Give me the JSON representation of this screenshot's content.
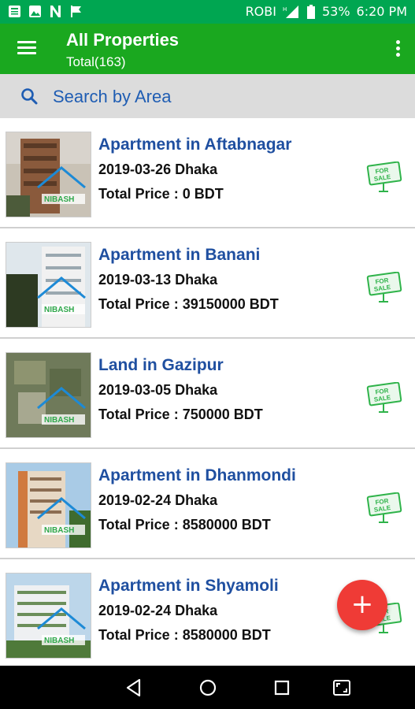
{
  "status_bar": {
    "carrier": "ROBI",
    "battery": "53%",
    "time": "6:20 PM",
    "left_icons": [
      "news-icon",
      "image-icon",
      "n-notification-icon",
      "flag-icon"
    ],
    "network_icon": "signal-icon",
    "battery_icon": "battery-icon"
  },
  "app_bar": {
    "title": "All Properties",
    "subtitle": "Total(163)",
    "menu_icon": "hamburger-menu-icon",
    "overflow_icon": "more-vert-icon"
  },
  "search": {
    "placeholder": "Search by Area",
    "icon": "search-icon"
  },
  "listings": [
    {
      "title": "Apartment in Aftabnagar",
      "meta": "2019-03-26 Dhaka",
      "price": "Total Price : 0 BDT",
      "badge": "for-sale-sign-icon",
      "watermark": "NIBASH"
    },
    {
      "title": "Apartment in Banani",
      "meta": "2019-03-13 Dhaka",
      "price": "Total Price : 39150000 BDT",
      "badge": "for-sale-sign-icon",
      "watermark": "NIBASH"
    },
    {
      "title": "Land in Gazipur",
      "meta": "2019-03-05 Dhaka",
      "price": "Total Price : 750000 BDT",
      "badge": "for-sale-sign-icon",
      "watermark": "NIBASH"
    },
    {
      "title": "Apartment in Dhanmondi",
      "meta": "2019-02-24 Dhaka",
      "price": "Total Price : 8580000 BDT",
      "badge": "for-sale-sign-icon",
      "watermark": "NIBASH"
    },
    {
      "title": "Apartment in Shyamoli",
      "meta": "2019-02-24 Dhaka",
      "price": "Total Price : 8580000 BDT",
      "badge": "for-sale-sign-icon",
      "watermark": "NIBASH"
    }
  ],
  "fab": {
    "label": "+",
    "icon": "add-icon"
  },
  "nav_bar": [
    "back-icon",
    "home-icon",
    "recents-icon",
    "screenshot-icon"
  ],
  "colors": {
    "status_bar": "#00a651",
    "app_bar": "#1aa81f",
    "search_bg": "#dcdcdc",
    "listing_title": "#1f4fa0",
    "fab": "#ef3b36",
    "sale_green": "#2fb34a"
  }
}
